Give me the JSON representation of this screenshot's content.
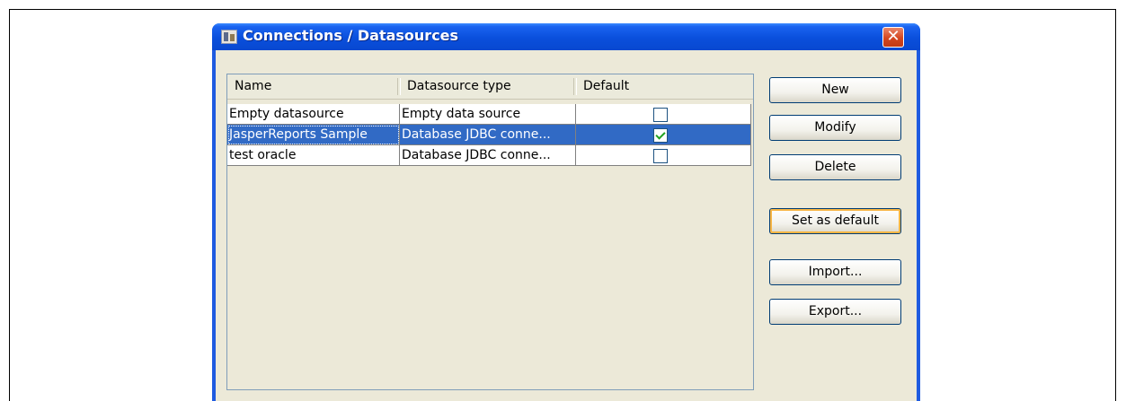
{
  "window": {
    "title": "Connections / Datasources",
    "close_glyph": "✕"
  },
  "table": {
    "columns": [
      "Name",
      "Datasource type",
      "Default"
    ],
    "rows": [
      {
        "name": "Empty datasource",
        "type": "Empty data source",
        "default": false,
        "selected": false
      },
      {
        "name": "JasperReports Sample",
        "type": "Database JDBC conne...",
        "default": true,
        "selected": true
      },
      {
        "name": "test oracle",
        "type": "Database JDBC conne...",
        "default": false,
        "selected": false
      }
    ]
  },
  "buttons": {
    "new": "New",
    "modify": "Modify",
    "delete": "Delete",
    "set_default": "Set as default",
    "import": "Import...",
    "export": "Export..."
  },
  "icons": {
    "app": "report-datasource-icon",
    "close": "close-icon",
    "check": "checkmark-icon"
  },
  "colors": {
    "titlebar": "#0a4fdc",
    "selection": "#316ac5",
    "dialog_bg": "#ece9d8",
    "check": "#21a121"
  }
}
